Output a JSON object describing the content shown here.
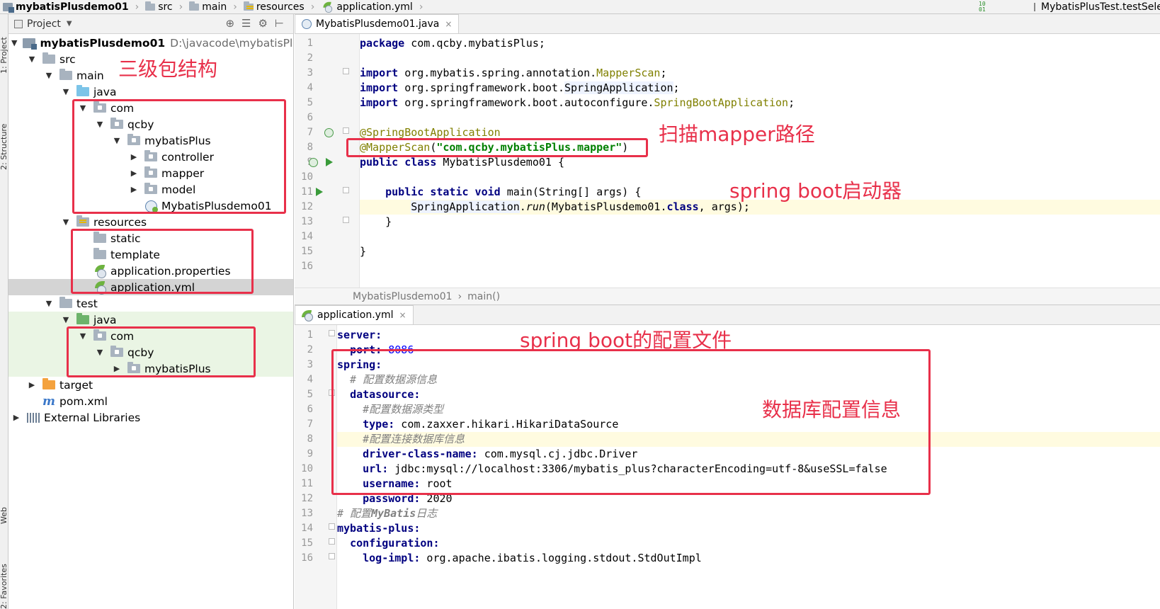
{
  "breadcrumb": {
    "items": [
      "mybatisPlusdemo01",
      "src",
      "main",
      "resources",
      "application.yml"
    ],
    "run_config": "MybatisPlusTest.testSelectB",
    "sort_icon_text": "10 01"
  },
  "left_strip": {
    "tabs": [
      "1: Project",
      "2: Structure",
      "Web",
      "2: Favorites"
    ]
  },
  "project_panel": {
    "title": "Project",
    "root_name": "mybatisPlusdemo01",
    "root_path": "D:\\javacode\\mybatisPlusde",
    "items": {
      "src": "src",
      "main": "main",
      "java": "java",
      "com": "com",
      "qcby": "qcby",
      "mybatisPlus": "mybatisPlus",
      "controller": "controller",
      "mapper": "mapper",
      "model": "model",
      "app_class": "MybatisPlusdemo01",
      "resources": "resources",
      "static": "static",
      "template": "template",
      "app_properties": "application.properties",
      "app_yml": "application.yml",
      "test": "test",
      "test_java": "java",
      "test_com": "com",
      "test_qcby": "qcby",
      "test_mybatisPlus": "mybatisPlus",
      "target": "target",
      "pom": "pom.xml",
      "ext_libs": "External Libraries"
    }
  },
  "annotations": {
    "three_level": "三级包结构",
    "scan_mapper": "扫描mapper路径",
    "boot_starter": "spring boot启动器",
    "boot_config": "spring boot的配置文件",
    "db_config": "数据库配置信息"
  },
  "editor_top": {
    "tab_label": "MybatisPlusdemo01.java",
    "tab_close": "×",
    "breadcrumb_class": "MybatisPlusdemo01",
    "breadcrumb_method": "main()",
    "line_numbers": [
      "1",
      "2",
      "3",
      "4",
      "5",
      "6",
      "7",
      "8",
      "9",
      "10",
      "11",
      "12",
      "13",
      "14",
      "15",
      "16"
    ],
    "code": {
      "l1_kw": "package",
      "l1_rest": " com.qcby.mybatisPlus;",
      "l3_kw": "import",
      "l3_pre": " org.mybatis.spring.annotation.",
      "l3_cls": "MapperScan",
      "l3_end": ";",
      "l4_kw": "import",
      "l4_pre": " org.springframework.boot.",
      "l4_cls": "SpringApplication",
      "l4_end": ";",
      "l5_kw": "import",
      "l5_pre": " org.springframework.boot.autoconfigure.",
      "l5_cls": "SpringBootApplication",
      "l5_end": ";",
      "l7_ann": "@SpringBootApplication",
      "l8_ann": "@MapperScan",
      "l8_open": "(",
      "l8_str": "\"com.qcby.mybatisPlus.mapper\"",
      "l8_close": ")",
      "l9_kw": "public class",
      "l9_rest": " MybatisPlusdemo01 {",
      "l11_indent": "    ",
      "l11_kw": "public static void",
      "l11_rest": " main(String[] args) {",
      "l12_indent": "        ",
      "l12_cls": "SpringApplication",
      "l12_dot": ".",
      "l12_method": "run",
      "l12_mid": "(MybatisPlusdemo01.",
      "l12_kw": "class",
      "l12_end": ", args);",
      "l13": "    }",
      "l15": "}"
    }
  },
  "editor_bottom": {
    "tab_label": "application.yml",
    "tab_close": "×",
    "line_numbers": [
      "1",
      "2",
      "3",
      "4",
      "5",
      "6",
      "7",
      "8",
      "9",
      "10",
      "11",
      "12",
      "13",
      "14",
      "15",
      "16"
    ],
    "yaml": {
      "l1_key": "server:",
      "l2_indent": "  ",
      "l2_key": "port:",
      "l2_val": " 8086",
      "l3_key": "spring:",
      "l4": "  # 配置数据源信息",
      "l5_indent": "  ",
      "l5_key": "datasource:",
      "l6": "    #配置数据源类型",
      "l7_indent": "    ",
      "l7_key": "type:",
      "l7_val": " com.zaxxer.hikari.HikariDataSource",
      "l8": "    #配置连接数据库信息",
      "l9_indent": "    ",
      "l9_key": "driver-class-name:",
      "l9_val": " com.mysql.cj.jdbc.Driver",
      "l10_indent": "    ",
      "l10_key": "url:",
      "l10_val": " jdbc:mysql://localhost:3306/mybatis_plus?characterEncoding=utf-8&useSSL=false",
      "l11_indent": "    ",
      "l11_key": "username:",
      "l11_val": " root",
      "l12_indent": "    ",
      "l12_key": "password:",
      "l12_val": " 2020",
      "l13_pre": "# 配置",
      "l13_ital": "MyBatis",
      "l13_post": "日志",
      "l14_key": "mybatis-plus:",
      "l15_indent": "  ",
      "l15_key": "configuration:",
      "l16_indent": "    ",
      "l16_key": "log-impl:",
      "l16_val": " org.apache.ibatis.logging.stdout.StdOutImpl"
    }
  },
  "colors": {
    "annotation_red": "#e8304a",
    "keyword": "#000080",
    "string": "#008000",
    "number": "#0000ff",
    "annotation": "#808000",
    "current_line": "#fffbe0",
    "selection": "#d4d4d4",
    "test_background": "#eaf5e4"
  }
}
